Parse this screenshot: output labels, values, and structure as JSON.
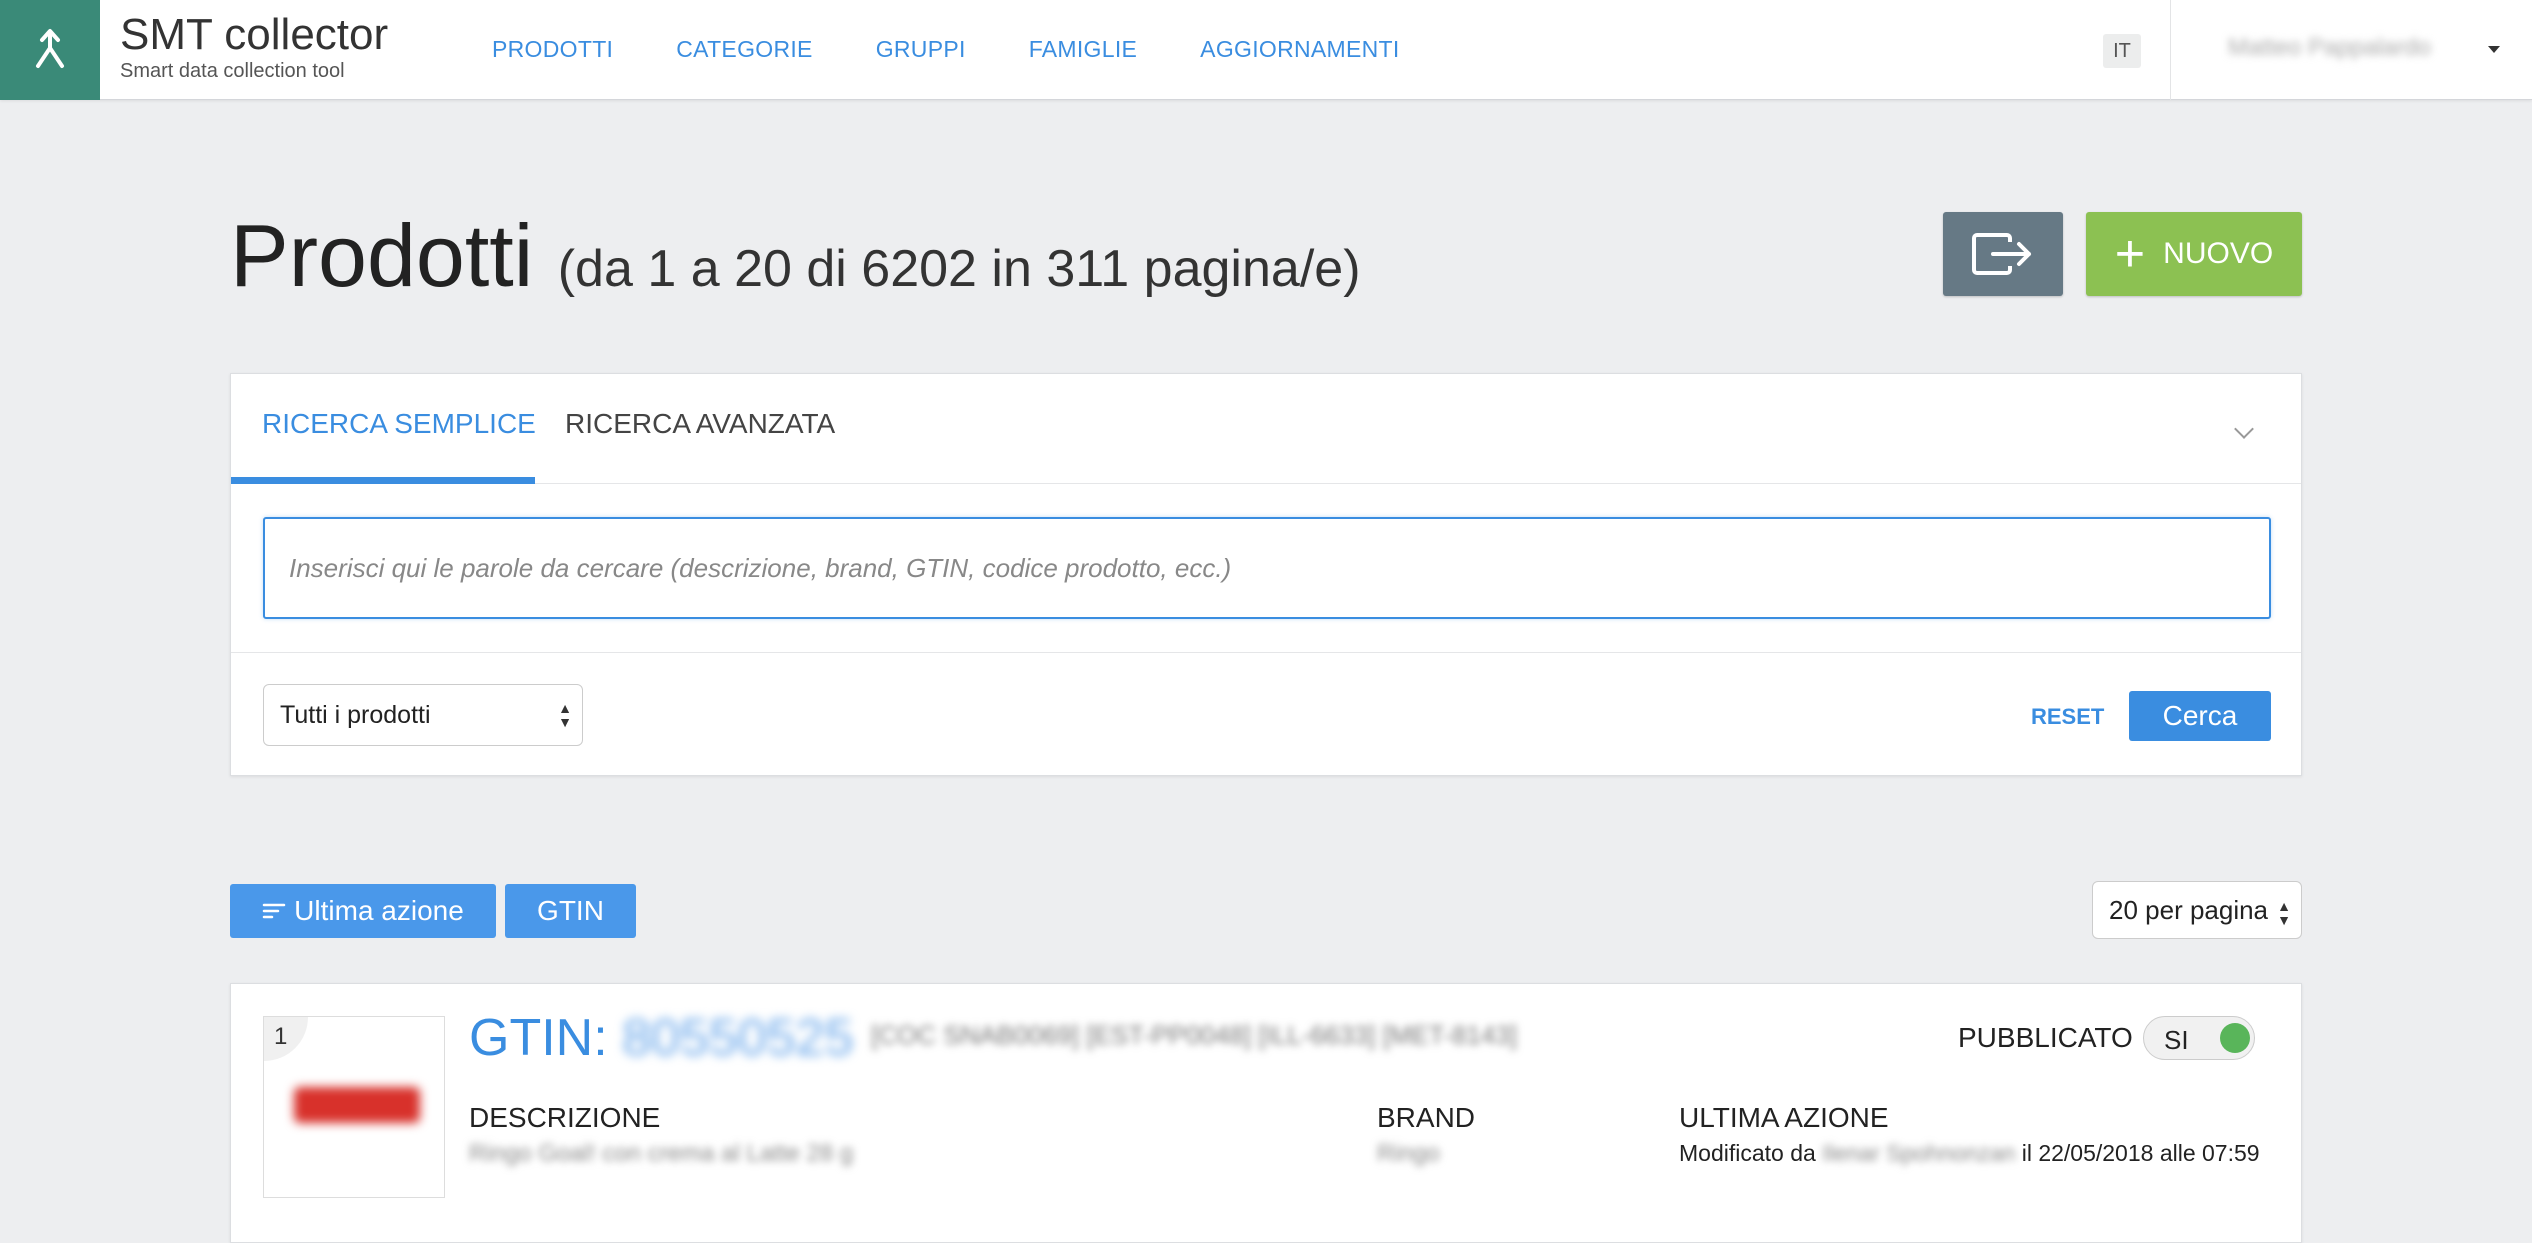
{
  "app": {
    "title": "SMT collector",
    "subtitle": "Smart data collection tool",
    "logo_icon": "merge-arrow-icon",
    "brand_color": "#3a8a78",
    "accent_color": "#3a8de0"
  },
  "nav": {
    "items": [
      {
        "label": "PRODOTTI"
      },
      {
        "label": "CATEGORIE"
      },
      {
        "label": "GRUPPI"
      },
      {
        "label": "FAMIGLIE"
      },
      {
        "label": "AGGIORNAMENTI"
      }
    ],
    "language": "IT",
    "user_name": "Matteo Pappalardo"
  },
  "page": {
    "title": "Prodotti",
    "subtitle": "(da 1 a 20 di 6202 in 311 pagina/e)",
    "export_icon": "export-icon",
    "new_label": "NUOVO",
    "new_icon": "plus-icon"
  },
  "search": {
    "tabs": [
      {
        "label": "RICERCA SEMPLICE",
        "active": true
      },
      {
        "label": "RICERCA AVANZATA",
        "active": false
      }
    ],
    "placeholder": "Inserisci qui le parole da cercare (descrizione, brand, GTIN, codice prodotto, ecc.)",
    "value": "",
    "filter_selected": "Tutti i prodotti",
    "reset_label": "RESET",
    "search_label": "Cerca"
  },
  "sort": {
    "buttons": [
      {
        "label": "Ultima azione",
        "icon": "sort-icon"
      },
      {
        "label": "GTIN"
      }
    ],
    "per_page": "20 per pagina"
  },
  "products": [
    {
      "index": "1",
      "gtin_label": "GTIN:",
      "gtin": "80550525",
      "codes": "[COC SNAB0069] [EST-PP0048] [ILL-6633] [MET-8143]",
      "published_label": "PUBBLICATO",
      "published_value": "SI",
      "published_color": "#59b55a",
      "desc_label": "DESCRIZIONE",
      "desc_value": "Ringo Goal! con crema al Latte 28 g",
      "brand_label": "BRAND",
      "brand_value": "Ringo",
      "action_label": "ULTIMA AZIONE",
      "action_prefix": "Modificato da",
      "action_user": "Ilenar Spohnonzan",
      "action_suffix": "il 22/05/2018 alle 07:59"
    }
  ]
}
